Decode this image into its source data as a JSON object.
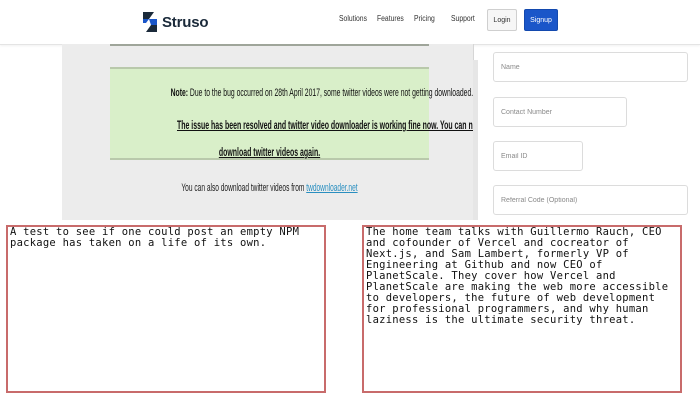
{
  "nav": {
    "brand": "Struso",
    "links": [
      "Solutions",
      "Features",
      "Pricing",
      "Support"
    ],
    "login_label": "Login",
    "signup_label": "Signup"
  },
  "notice": {
    "note_label": "Note:",
    "note_text": " Due to the bug occurred on 28th April 2017, some twitter videos were not getting downloaded.",
    "resolved_line1": "The issue has been resolved and twitter video downloader is working fine now. You can now",
    "resolved_line2": "download twitter videos again.",
    "also_text": "You can also download twitter videos from ",
    "also_link": "twdownloader.net"
  },
  "form": {
    "name_placeholder": "Name",
    "contact_placeholder": "Contact Number",
    "email_placeholder": "Email ID",
    "referral_placeholder": "Referral Code (Optional)"
  },
  "boxes": {
    "left_text": "A test to see if one could post an empty NPM package has taken on a life of its own.",
    "right_text": "The home team talks with Guillermo Rauch, CEO and cofounder of Vercel and cocreator of Next.js, and Sam Lambert, formerly VP of Engineering at Github and now CEO of PlanetScale. They cover how Vercel and PlanetScale are making the web more accessible to developers, the future of web development for professional programmers, and why human laziness is the ultimate security threat."
  },
  "colors": {
    "brand_navy": "#1b2a3a",
    "signup_blue": "#1a56c9",
    "notice_green": "#d9efc9",
    "box_border": "#c86b6b"
  },
  "icons": {
    "brand_logo": "struso-s-logo-icon"
  }
}
